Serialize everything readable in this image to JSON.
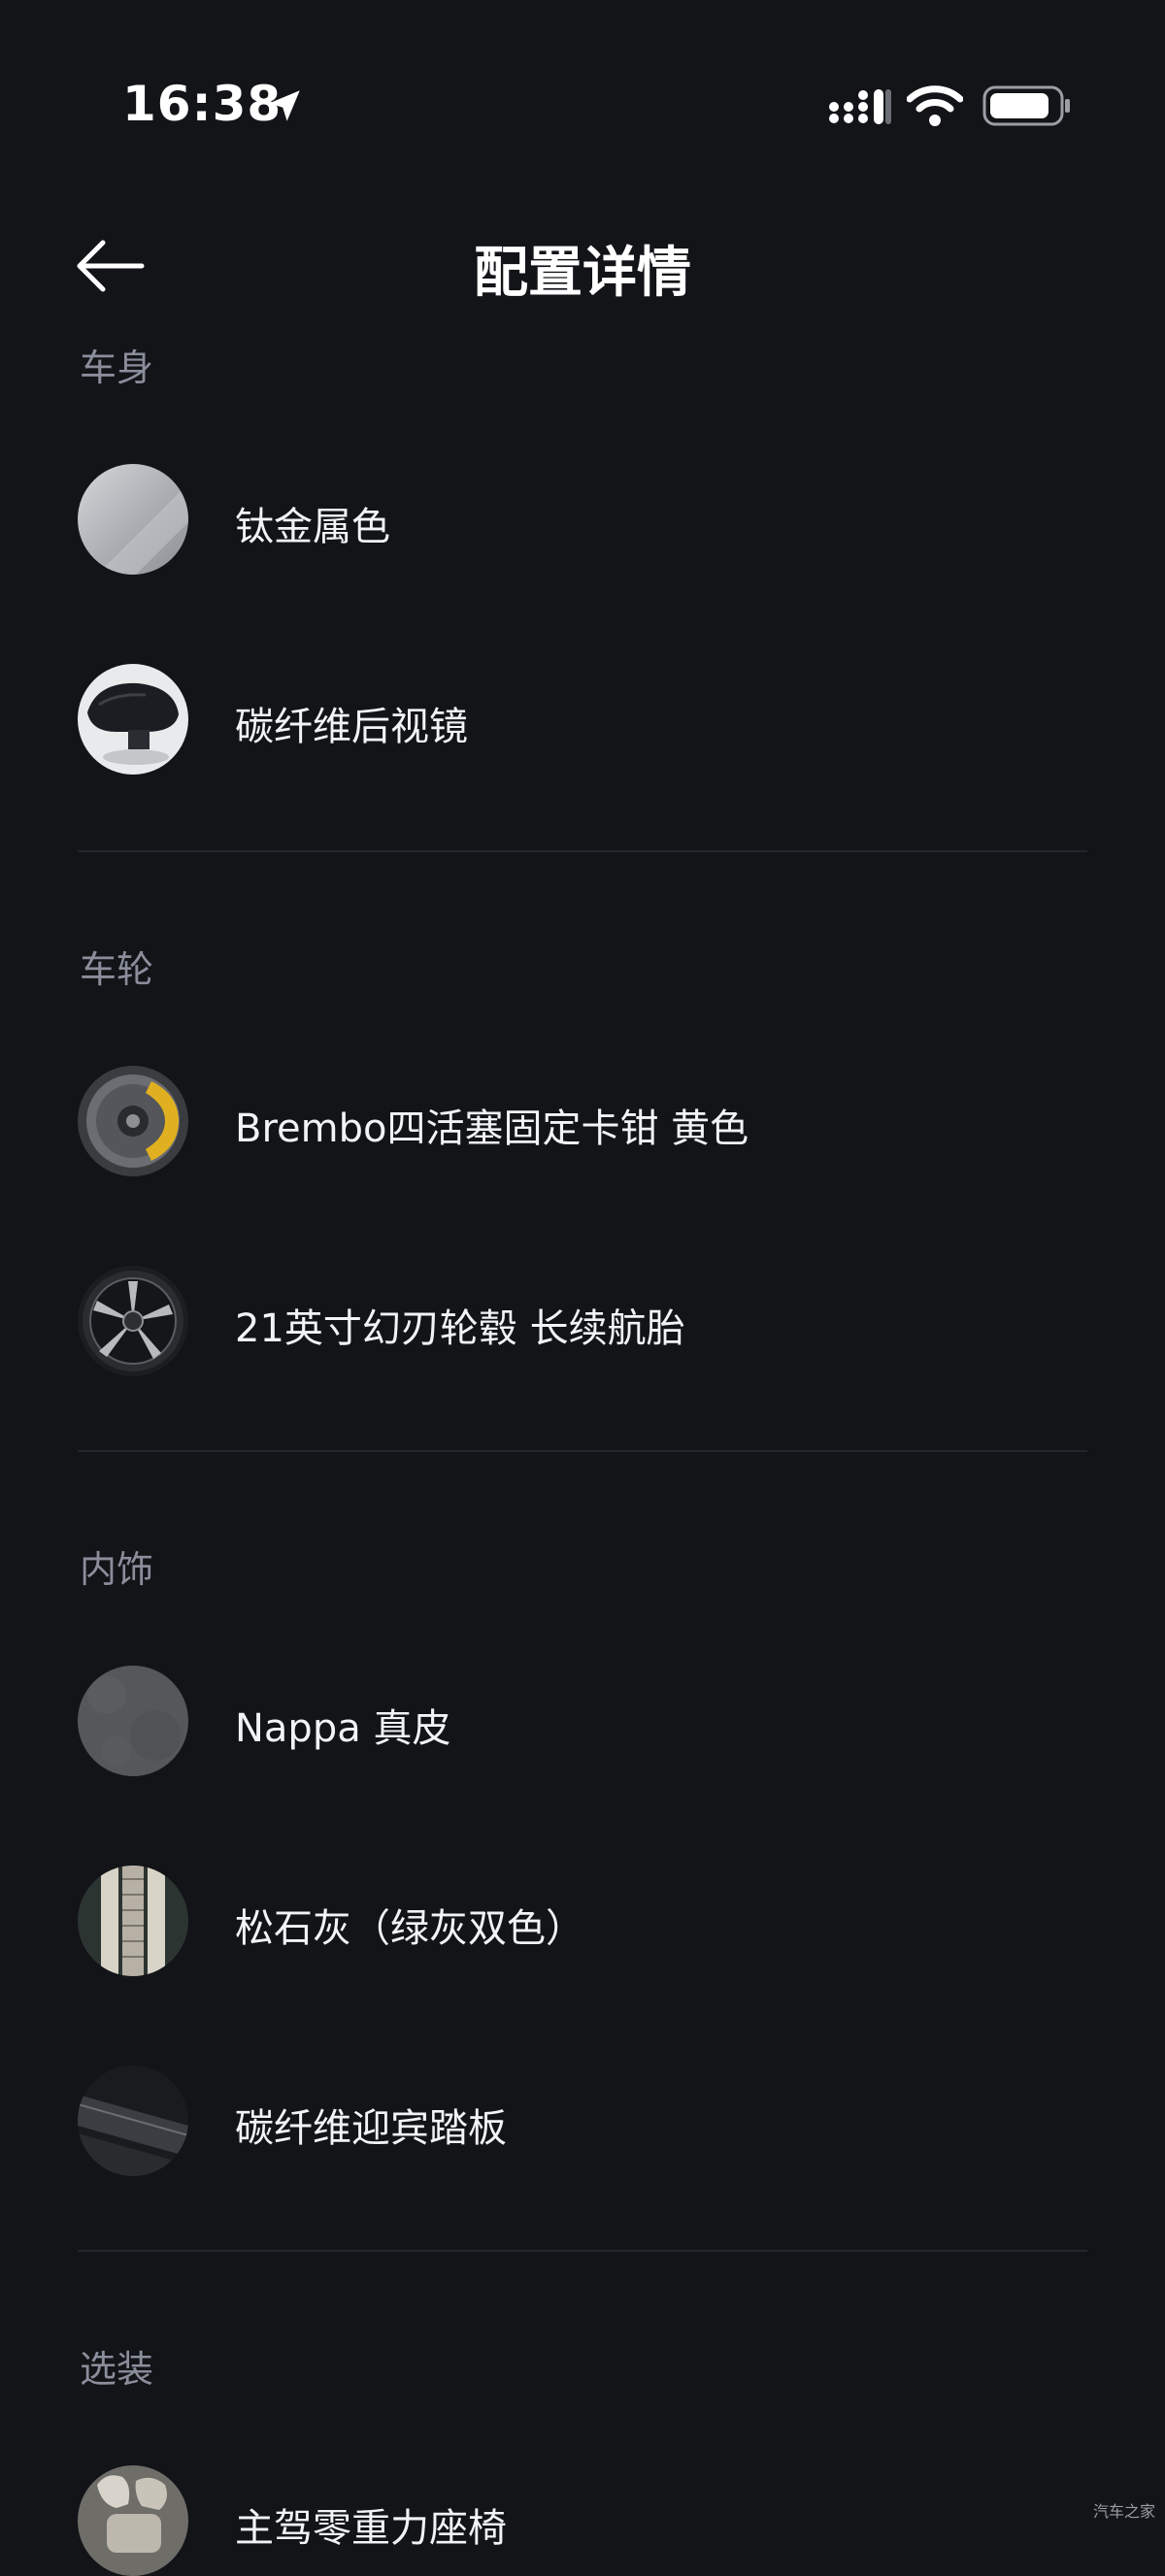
{
  "status_bar": {
    "time": "16:38",
    "icons": [
      "location-arrow-icon",
      "cellular-signal-icon",
      "wifi-icon",
      "battery-icon"
    ]
  },
  "header": {
    "title": "配置详情",
    "back_icon": "arrow-left-icon"
  },
  "sections": [
    {
      "title": "车身",
      "items": [
        {
          "label": "钛金属色",
          "thumb": "titanium-paint-swatch"
        },
        {
          "label": "碳纤维后视镜",
          "thumb": "carbon-mirror-photo"
        }
      ]
    },
    {
      "title": "车轮",
      "items": [
        {
          "label": "Brembo四活塞固定卡钳 黄色",
          "thumb": "brake-caliper-photo"
        },
        {
          "label": "21英寸幻刃轮毂 长续航胎",
          "thumb": "wheel-rim-photo"
        }
      ]
    },
    {
      "title": "内饰",
      "items": [
        {
          "label": "Nappa 真皮",
          "thumb": "leather-swatch"
        },
        {
          "label": "松石灰（绿灰双色）",
          "thumb": "two-tone-fabric-swatch"
        },
        {
          "label": "碳纤维迎宾踏板",
          "thumb": "scuff-plate-photo"
        }
      ]
    },
    {
      "title": "选装",
      "items": [
        {
          "label": "主驾零重力座椅",
          "thumb": "seat-photo"
        }
      ]
    }
  ],
  "colors": {
    "background": "#121418",
    "section_title": "#8a8e9b",
    "text": "#f2f3f5",
    "divider": "#23262c",
    "caliper_yellow": "#e0b020"
  },
  "watermark": "汽车之家"
}
